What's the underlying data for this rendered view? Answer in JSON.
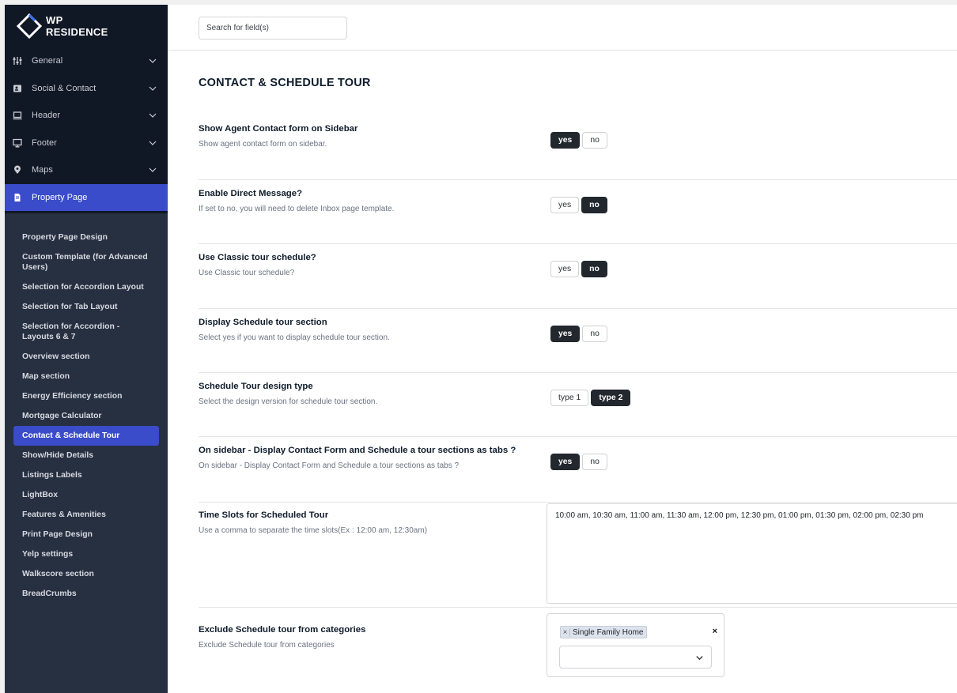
{
  "brand": {
    "line1": "WP",
    "line2": "RESIDENCE"
  },
  "sidebar": {
    "items": [
      {
        "label": "General",
        "icon": "sliders-icon"
      },
      {
        "label": "Social & Contact",
        "icon": "contact-card-icon"
      },
      {
        "label": "Header",
        "icon": "laptop-icon"
      },
      {
        "label": "Footer",
        "icon": "monitor-icon"
      },
      {
        "label": "Maps",
        "icon": "map-pin-icon"
      },
      {
        "label": "Property Page",
        "icon": "document-icon",
        "active": true
      }
    ],
    "subitems": [
      "Property Page Design",
      "Custom Template (for Advanced Users)",
      "Selection for Accordion Layout",
      "Selection for Tab Layout",
      "Selection for Accordion - Layouts 6 & 7",
      "Overview section",
      "Map section",
      "Energy Efficiency section",
      "Mortgage Calculator",
      "Contact & Schedule Tour",
      "Show/Hide Details",
      "Listings Labels",
      "LightBox",
      "Features & Amenities",
      "Print Page Design",
      "Yelp settings",
      "Walkscore section",
      "BreadCrumbs"
    ],
    "active_subitem": "Contact & Schedule Tour"
  },
  "search": {
    "placeholder": "Search for field(s)"
  },
  "page_title": "CONTACT & SCHEDULE TOUR",
  "settings": [
    {
      "title": "Show Agent Contact form on Sidebar",
      "desc": "Show agent contact form on sidebar.",
      "options": [
        "yes",
        "no"
      ],
      "selected": "yes"
    },
    {
      "title": "Enable Direct Message?",
      "desc": "If set to no, you will need to delete Inbox page template.",
      "options": [
        "yes",
        "no"
      ],
      "selected": "no"
    },
    {
      "title": "Use Classic tour schedule?",
      "desc": "Use Classic tour schedule?",
      "options": [
        "yes",
        "no"
      ],
      "selected": "no"
    },
    {
      "title": "Display Schedule tour section",
      "desc": "Select yes if you want to display schedule tour section.",
      "options": [
        "yes",
        "no"
      ],
      "selected": "yes"
    },
    {
      "title": "Schedule Tour design type",
      "desc": "Select the design version for schedule tour section.",
      "options": [
        "type 1",
        "type 2"
      ],
      "selected": "type 2"
    },
    {
      "title": "On sidebar - Display Contact Form and Schedule a tour sections as tabs ?",
      "desc": "On sidebar - Display Contact Form and Schedule a tour sections as tabs ?",
      "options": [
        "yes",
        "no"
      ],
      "selected": "yes"
    }
  ],
  "time_slots": {
    "title": "Time Slots for Scheduled Tour",
    "desc": "Use a comma to separate the time slots(Ex : 12:00 am, 12:30am)",
    "value": "10:00 am, 10:30 am, 11:00 am, 11:30 am, 12:00 pm, 12:30 pm,  01:00 pm,  01:30 pm,  02:00 pm, 02:30 pm"
  },
  "exclude": {
    "title": "Exclude Schedule tour from categories",
    "desc": "Exclude Schedule tour from categories",
    "chip_remove": "×",
    "chips": [
      "Single Family Home"
    ],
    "clear": "×"
  },
  "colors": {
    "accent": "#3a4cc9",
    "sidebar_bg": "#101725",
    "subnav_bg": "#273041",
    "toggle_on": "#23272e"
  }
}
